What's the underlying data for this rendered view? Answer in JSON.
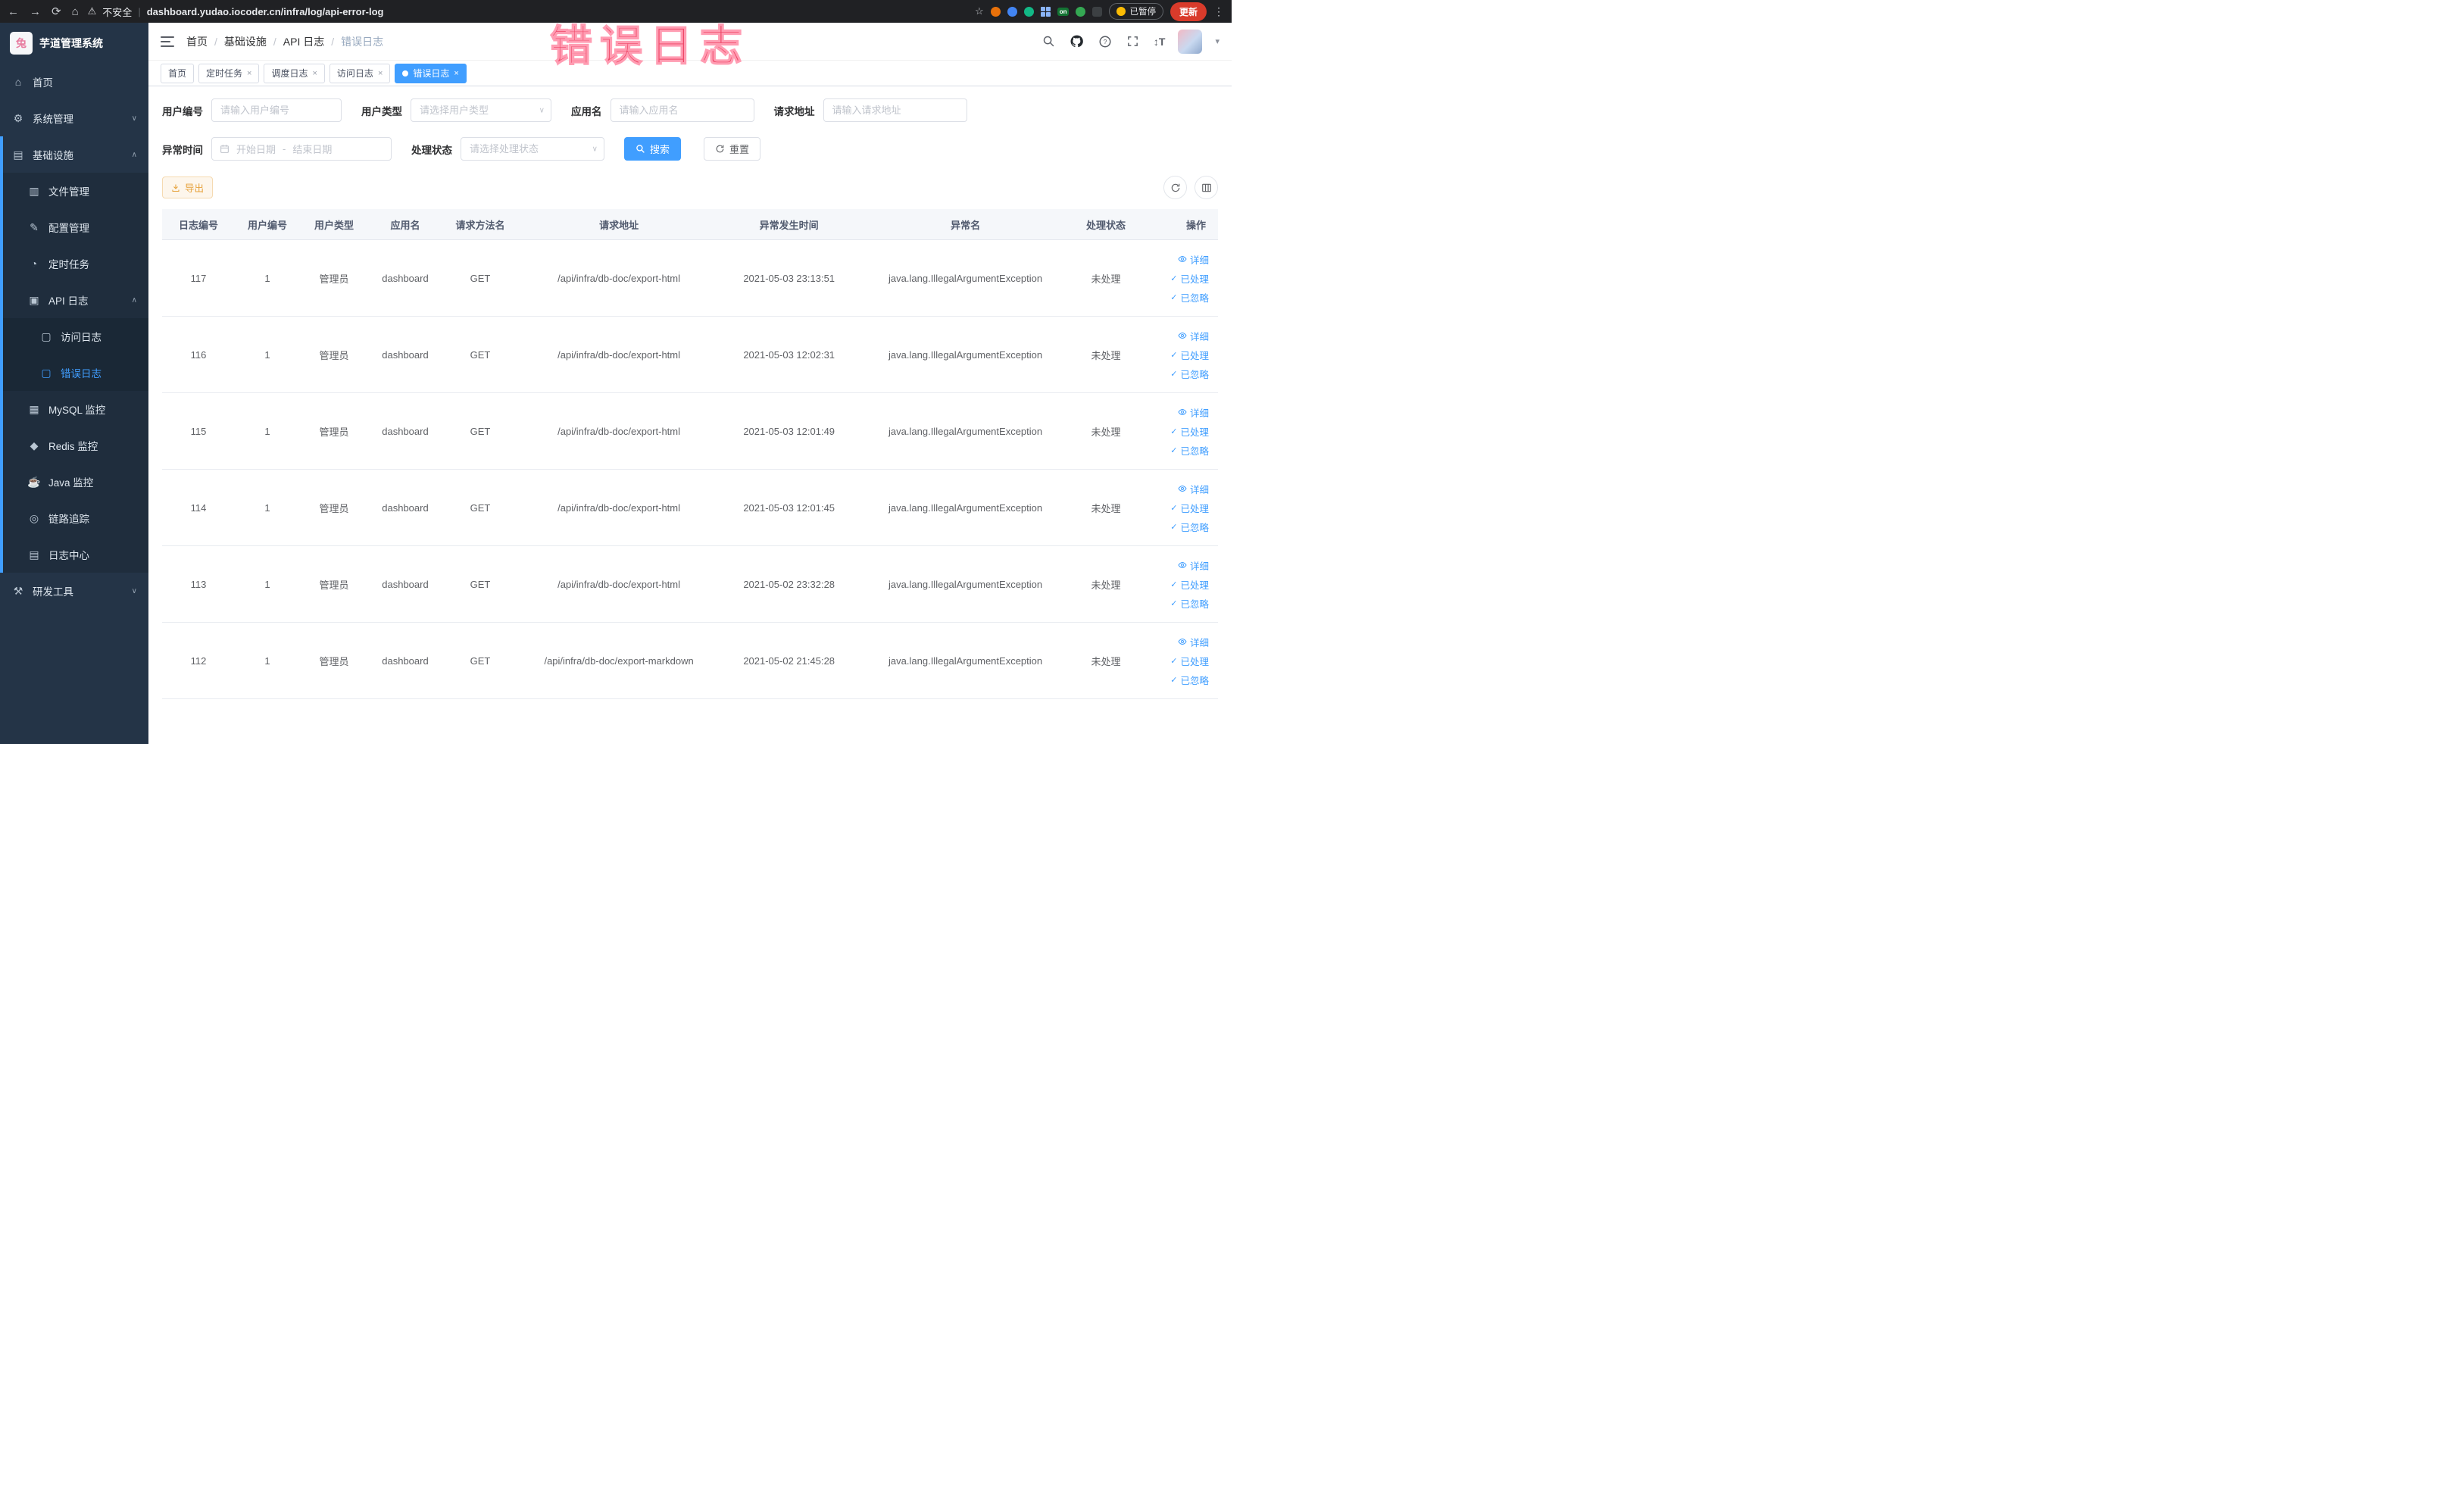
{
  "colors": {
    "accent": "#409eff",
    "sidebar_bg": "#243447",
    "warning": "#e6a23c",
    "annotation": "#ee4465",
    "tab_active_bg": "#409eff",
    "update_button_bg": "#d93b2b"
  },
  "annotation": {
    "text": "错误日志"
  },
  "browser": {
    "security_label": "不安全",
    "url": "dashboard.yudao.iocoder.cn/infra/log/api-error-log",
    "extension_on_label": "on",
    "paused_badge": "已暂停",
    "update_button": "更新"
  },
  "sidebar": {
    "logo_title": "芋道管理系统",
    "logo_letter": "兔",
    "items": [
      {
        "label": "首页"
      },
      {
        "label": "系统管理"
      },
      {
        "label": "基础设施"
      },
      {
        "label": "文件管理"
      },
      {
        "label": "配置管理"
      },
      {
        "label": "定时任务"
      },
      {
        "label": "API 日志"
      },
      {
        "label": "访问日志"
      },
      {
        "label": "错误日志"
      },
      {
        "label": "MySQL 监控"
      },
      {
        "label": "Redis 监控"
      },
      {
        "label": "Java 监控"
      },
      {
        "label": "链路追踪"
      },
      {
        "label": "日志中心"
      },
      {
        "label": "研发工具"
      }
    ]
  },
  "breadcrumb": {
    "items": [
      {
        "label": "首页"
      },
      {
        "label": "基础设施"
      },
      {
        "label": "API 日志"
      },
      {
        "label": "错误日志"
      }
    ]
  },
  "tabs": {
    "items": [
      {
        "label": "首页"
      },
      {
        "label": "定时任务"
      },
      {
        "label": "调度日志"
      },
      {
        "label": "访问日志"
      },
      {
        "label": "错误日志"
      }
    ]
  },
  "filters": {
    "user_id_label": "用户编号",
    "user_id_placeholder": "请输入用户编号",
    "user_type_label": "用户类型",
    "user_type_placeholder": "请选择用户类型",
    "app_label": "应用名",
    "app_placeholder": "请输入应用名",
    "url_label": "请求地址",
    "url_placeholder": "请输入请求地址",
    "time_label": "异常时间",
    "start_placeholder": "开始日期",
    "range_separator": "-",
    "end_placeholder": "结束日期",
    "status_label": "处理状态",
    "status_placeholder": "请选择处理状态",
    "search_label": "搜索",
    "reset_label": "重置"
  },
  "toolbar": {
    "export_label": "导出"
  },
  "table": {
    "columns": [
      {
        "label": "日志编号"
      },
      {
        "label": "用户编号"
      },
      {
        "label": "用户类型"
      },
      {
        "label": "应用名"
      },
      {
        "label": "请求方法名"
      },
      {
        "label": "请求地址"
      },
      {
        "label": "异常发生时间"
      },
      {
        "label": "异常名"
      },
      {
        "label": "处理状态"
      },
      {
        "label": "操作"
      }
    ],
    "actions": {
      "detail": "详细",
      "processed": "已处理",
      "ignored": "已忽略"
    },
    "rows": [
      {
        "id": "117",
        "user_id": "1",
        "user_type": "管理员",
        "app": "dashboard",
        "method": "GET",
        "url": "/api/infra/db-doc/export-html",
        "time": "2021-05-03 23:13:51",
        "exception": "java.lang.IllegalArgumentException",
        "status": "未处理"
      },
      {
        "id": "116",
        "user_id": "1",
        "user_type": "管理员",
        "app": "dashboard",
        "method": "GET",
        "url": "/api/infra/db-doc/export-html",
        "time": "2021-05-03 12:02:31",
        "exception": "java.lang.IllegalArgumentException",
        "status": "未处理"
      },
      {
        "id": "115",
        "user_id": "1",
        "user_type": "管理员",
        "app": "dashboard",
        "method": "GET",
        "url": "/api/infra/db-doc/export-html",
        "time": "2021-05-03 12:01:49",
        "exception": "java.lang.IllegalArgumentException",
        "status": "未处理"
      },
      {
        "id": "114",
        "user_id": "1",
        "user_type": "管理员",
        "app": "dashboard",
        "method": "GET",
        "url": "/api/infra/db-doc/export-html",
        "time": "2021-05-03 12:01:45",
        "exception": "java.lang.IllegalArgumentException",
        "status": "未处理"
      },
      {
        "id": "113",
        "user_id": "1",
        "user_type": "管理员",
        "app": "dashboard",
        "method": "GET",
        "url": "/api/infra/db-doc/export-html",
        "time": "2021-05-02 23:32:28",
        "exception": "java.lang.IllegalArgumentException",
        "status": "未处理"
      },
      {
        "id": "112",
        "user_id": "1",
        "user_type": "管理员",
        "app": "dashboard",
        "method": "GET",
        "url": "/api/infra/db-doc/export-markdown",
        "time": "2021-05-02 21:45:28",
        "exception": "java.lang.IllegalArgumentException",
        "status": "未处理"
      }
    ]
  }
}
